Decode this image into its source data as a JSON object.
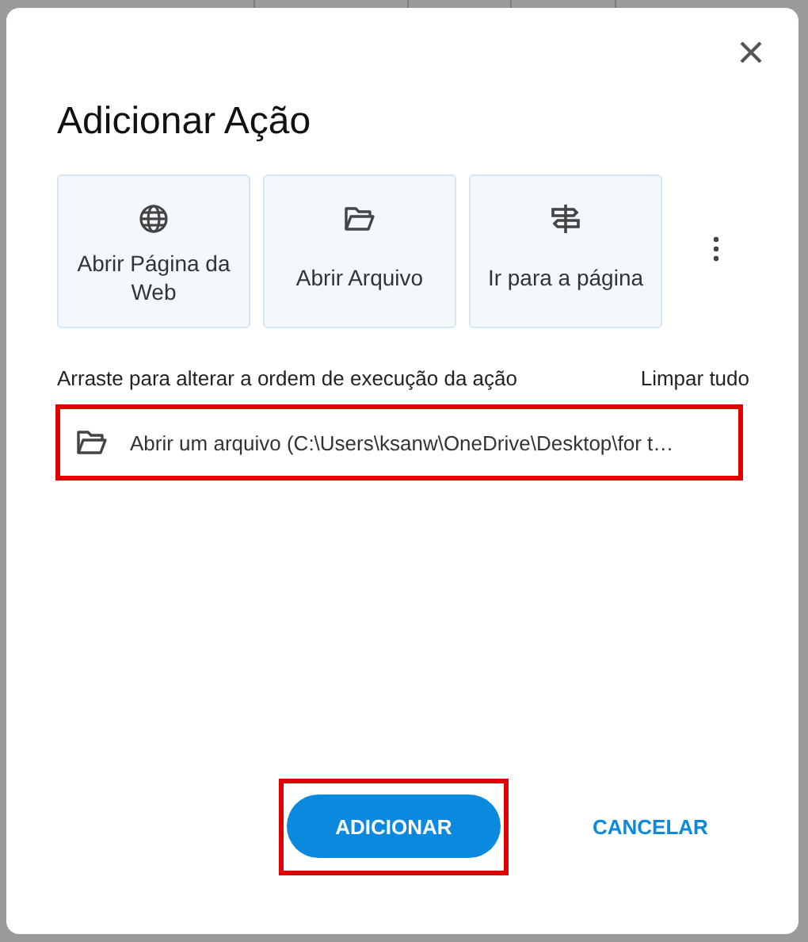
{
  "dialog": {
    "title": "Adicionar Ação",
    "actions": [
      {
        "kind": "web",
        "label": "Abrir Página da Web"
      },
      {
        "kind": "file",
        "label": "Abrir Arquivo"
      },
      {
        "kind": "goto",
        "label": "Ir para a página"
      }
    ],
    "instruction": "Arraste para alterar a ordem de execução da ação",
    "clear_all": "Limpar tudo",
    "steps": [
      {
        "kind": "file",
        "label": "Abrir um arquivo (C:\\Users\\ksanw\\OneDrive\\Desktop\\for t…",
        "highlighted": true
      }
    ],
    "buttons": [
      {
        "kind": "primary",
        "label": "ADICIONAR",
        "highlighted": true
      },
      {
        "kind": "text",
        "label": "CANCELAR",
        "highlighted": false
      }
    ]
  }
}
